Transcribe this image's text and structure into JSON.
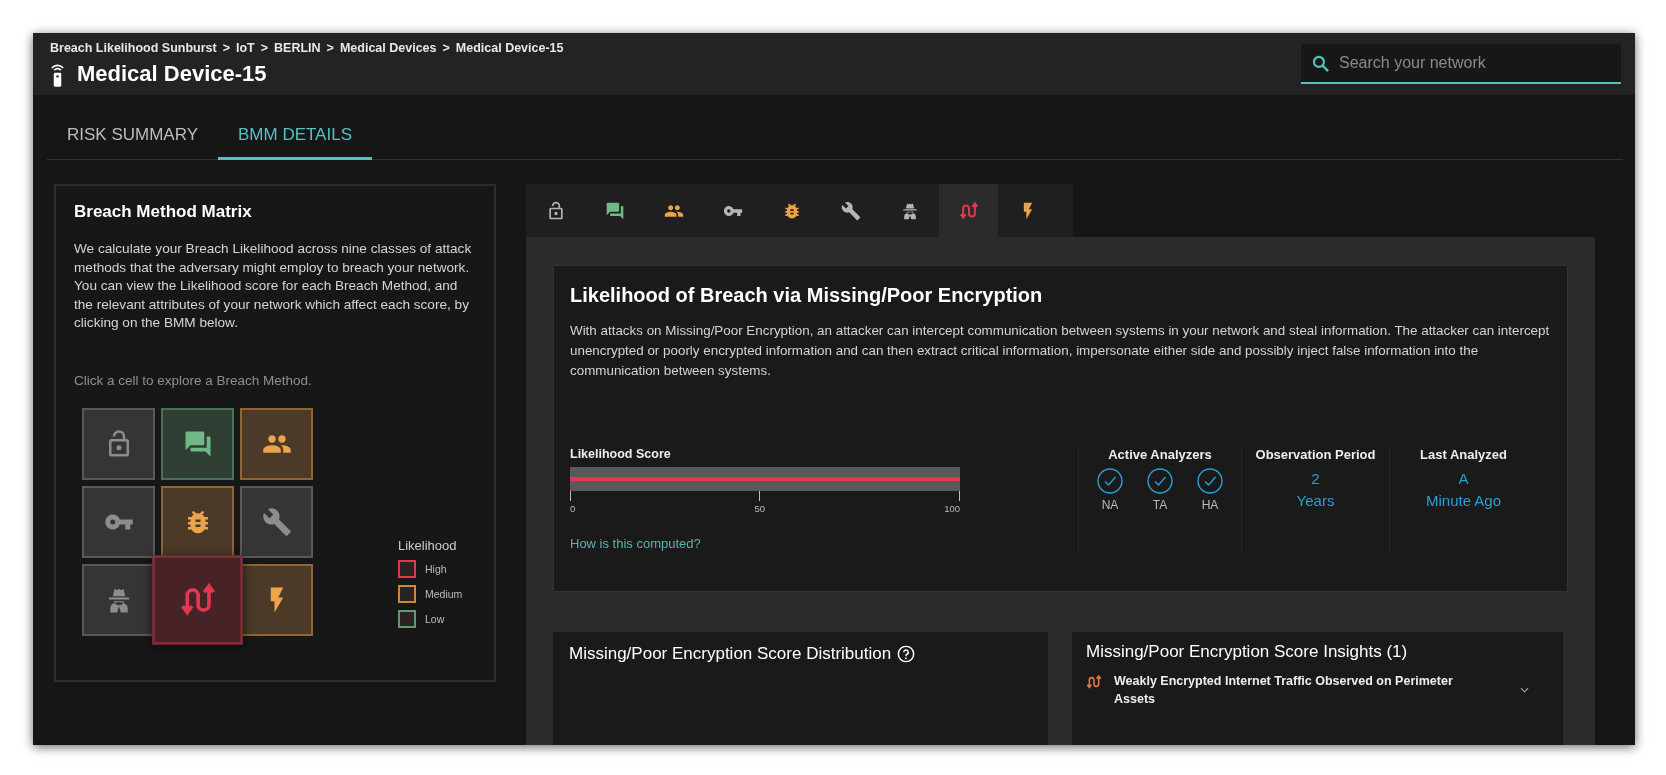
{
  "breadcrumb": [
    "Breach Likelihood Sunburst",
    "IoT",
    "BERLIN",
    "Medical Devices",
    "Medical Device-15"
  ],
  "breadcrumb_separator": ">",
  "title": "Medical Device-15",
  "search": {
    "placeholder": "Search your network"
  },
  "tabs": [
    {
      "label": "RISK SUMMARY",
      "selected": false
    },
    {
      "label": "BMM DETAILS",
      "selected": true
    }
  ],
  "matrix_panel": {
    "title": "Breach Method Matrix",
    "description": "We calculate your Breach Likelihood across nine classes of attack methods that the adversary might employ to breach your network. You can view the Likelihood score for each Breach Method, and the relevant attributes of your network which affect each score, by clicking on the BMM below.",
    "hint": "Click a cell to explore a Breach Method.",
    "cells": [
      {
        "kind": "lock",
        "color": "#8d8d8d",
        "selected": false
      },
      {
        "kind": "chat",
        "color": "#70b886",
        "selected": false
      },
      {
        "kind": "people",
        "color": "#eda34c",
        "selected": false
      },
      {
        "kind": "key",
        "color": "#8d8d8d",
        "selected": false
      },
      {
        "kind": "bug",
        "color": "#eda34c",
        "selected": false
      },
      {
        "kind": "wrench",
        "color": "#8d8d8d",
        "selected": false
      },
      {
        "kind": "spy",
        "color": "#8d8d8d",
        "selected": false
      },
      {
        "kind": "swap",
        "color": "#e0384f",
        "selected": true
      },
      {
        "kind": "bolt",
        "color": "#eda34c",
        "selected": false
      }
    ],
    "legend": {
      "title": "Likelihood",
      "items": [
        {
          "label": "High",
          "color": "#e0384f"
        },
        {
          "label": "Medium",
          "color": "#c98a3f"
        },
        {
          "label": "Low",
          "color": "#5f9a6f"
        }
      ]
    }
  },
  "method_tabs": [
    {
      "kind": "lock",
      "color": "#b5b5b5",
      "selected": false
    },
    {
      "kind": "chat",
      "color": "#70b886",
      "selected": false
    },
    {
      "kind": "people",
      "color": "#eda34c",
      "selected": false
    },
    {
      "kind": "key",
      "color": "#b5b5b5",
      "selected": false
    },
    {
      "kind": "bug",
      "color": "#eda34c",
      "selected": false
    },
    {
      "kind": "wrench",
      "color": "#b5b5b5",
      "selected": false
    },
    {
      "kind": "spy",
      "color": "#b5b5b5",
      "selected": false
    },
    {
      "kind": "swap",
      "color": "#e0384f",
      "selected": true
    },
    {
      "kind": "bolt",
      "color": "#eda34c",
      "selected": false
    }
  ],
  "detail": {
    "title": "Likelihood of Breach via Missing/Poor Encryption",
    "description": "With attacks on Missing/Poor Encryption, an attacker can intercept communication between systems in your network and steal information. The attacker can intercept unencrypted or poorly encrypted information and can then extract critical information, impersonate either side and possibly inject false information into the communication between systems.",
    "score": {
      "label": "Likelihood Score",
      "level": 1,
      "ticks": [
        "0",
        "50",
        "100"
      ],
      "link": "How is this computed?"
    },
    "analyzers": {
      "title": "Active Analyzers",
      "items": [
        {
          "label": "NA",
          "checked": true
        },
        {
          "label": "TA",
          "checked": true
        },
        {
          "label": "HA",
          "checked": true
        }
      ]
    },
    "observation_period": {
      "title": "Observation Period",
      "value": [
        "2",
        "Years"
      ]
    },
    "last_analyzed": {
      "title": "Last Analyzed",
      "value": [
        "A",
        "Minute Ago"
      ]
    }
  },
  "distribution": {
    "title": "Missing/Poor Encryption Score Distribution"
  },
  "insights": {
    "title": "Missing/Poor Encryption Score Insights (1)",
    "items": [
      {
        "kind": "swap",
        "text": "Weakly Encrypted Internet Traffic Observed on Perimeter Assets",
        "expanded": false
      }
    ]
  }
}
